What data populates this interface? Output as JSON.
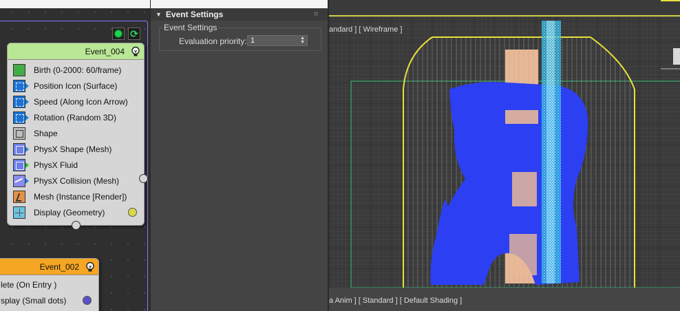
{
  "particle_view": {
    "event_004": {
      "title": "Event_004",
      "operators": [
        {
          "label": "Birth (0-2000: 60/frame)",
          "icon": "birth-icon"
        },
        {
          "label": "Position Icon (Surface)",
          "icon": "position-icon"
        },
        {
          "label": "Speed (Along Icon Arrow)",
          "icon": "speed-icon"
        },
        {
          "label": "Rotation (Random 3D)",
          "icon": "rotation-icon"
        },
        {
          "label": "Shape",
          "icon": "shape-icon"
        },
        {
          "label": "PhysX Shape (Mesh)",
          "icon": "physx-shape-icon"
        },
        {
          "label": "PhysX Fluid",
          "icon": "physx-fluid-icon"
        },
        {
          "label": "PhysX Collision (Mesh)",
          "icon": "physx-collision-icon"
        },
        {
          "label": "Mesh (Instance [Render])",
          "icon": "mesh-icon"
        },
        {
          "label": "Display (Geometry)",
          "icon": "display-icon"
        }
      ],
      "display_color": "#d8d84a"
    },
    "event_002": {
      "title": "Event_002",
      "operators": [
        {
          "label": "lete (On Entry )",
          "icon": "delete-icon"
        },
        {
          "label": "splay (Small dots)",
          "icon": "display-icon"
        }
      ],
      "display_color": "#5d4fc8"
    }
  },
  "event_settings": {
    "rollout_title": "Event Settings",
    "group_label": "Event Settings",
    "priority_label": "Evaluation priority:",
    "priority_value": "1"
  },
  "viewport": {
    "top_label": "andard ] [ Wireframe ]",
    "bottom_label": "a Anim ] [ Standard ] [ Default Shading ]"
  },
  "colors": {
    "event_header_green": "#b9e795",
    "event_header_orange": "#f5a623",
    "selection_frame": "#7d7dff",
    "bounding_box": "#e8e23a",
    "fluid_blue": "#2c3ff2",
    "stream_cyan": "#5ad8f0",
    "wood": "#e8b896"
  }
}
